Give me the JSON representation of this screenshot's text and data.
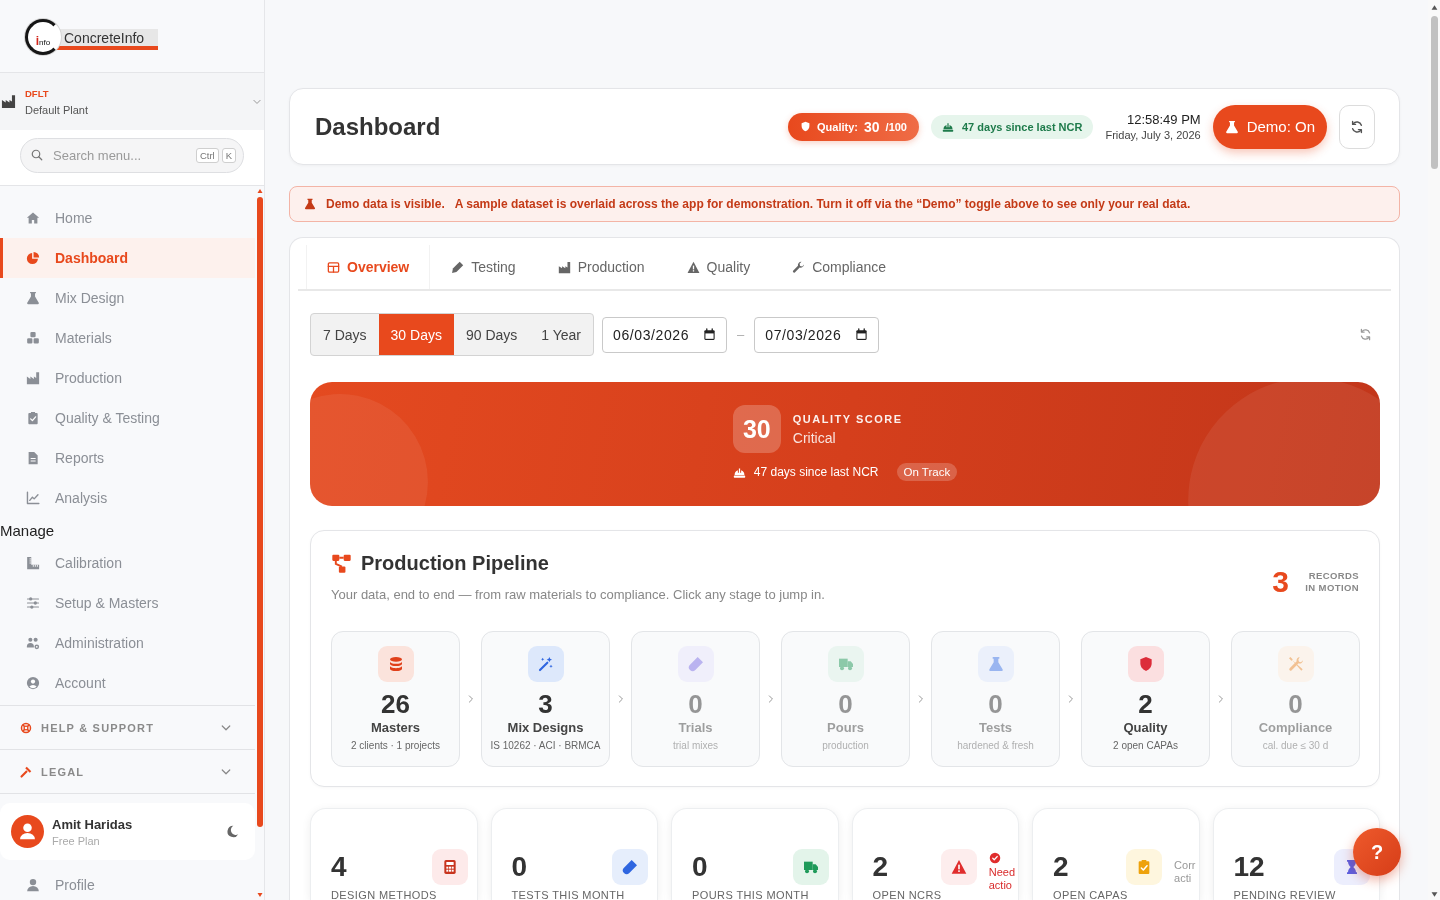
{
  "sidebar": {
    "logo": {
      "mark": "info",
      "text": "ConcreteInfo"
    },
    "plant": {
      "code": "DFLT",
      "name": "Default Plant"
    },
    "search": {
      "placeholder": "Search menu...",
      "shortcut": [
        "Ctrl",
        "K"
      ]
    },
    "nav": [
      {
        "label": "Home",
        "selected": false
      },
      {
        "label": "Dashboard",
        "selected": true
      },
      {
        "label": "Mix Design",
        "selected": false
      },
      {
        "label": "Materials",
        "selected": false
      },
      {
        "label": "Production",
        "selected": false
      },
      {
        "label": "Quality & Testing",
        "selected": false
      },
      {
        "label": "Reports",
        "selected": false
      },
      {
        "label": "Analysis",
        "selected": false
      }
    ],
    "manage_heading": "Manage",
    "manage": [
      {
        "label": "Calibration",
        "selected": false
      },
      {
        "label": "Setup & Masters",
        "selected": false
      },
      {
        "label": "Administration",
        "selected": false
      },
      {
        "label": "Account",
        "selected": false
      }
    ],
    "groups": [
      {
        "label": "HELP & SUPPORT",
        "expanded": false
      },
      {
        "label": "LEGAL",
        "expanded": false
      }
    ],
    "user": {
      "name": "Amit Haridas",
      "plan": "Free Plan"
    },
    "footer_nav": [
      {
        "label": "Profile",
        "selected": false
      }
    ]
  },
  "header": {
    "title": "Dashboard",
    "quality_badge": {
      "label": "Quality:",
      "score": "30",
      "max": "/100"
    },
    "ncr_badge": "47 days since last NCR",
    "time": "12:58:49 PM",
    "date": "Friday, July 3, 2026",
    "demo_button": {
      "label": "Demo: On",
      "on": true
    }
  },
  "demo_banner": {
    "title": "Demo data is visible.",
    "message": "A sample dataset is overlaid across the app for demonstration. Turn it off via the “Demo” toggle above to see only your real data."
  },
  "tabs": [
    {
      "label": "Overview",
      "selected": true
    },
    {
      "label": "Testing",
      "selected": false
    },
    {
      "label": "Production",
      "selected": false
    },
    {
      "label": "Quality",
      "selected": false
    },
    {
      "label": "Compliance",
      "selected": false
    }
  ],
  "range": {
    "presets": [
      {
        "label": "7 Days",
        "selected": false
      },
      {
        "label": "30 Days",
        "selected": true
      },
      {
        "label": "90 Days",
        "selected": false
      },
      {
        "label": "1 Year",
        "selected": false
      }
    ],
    "from": "06/03/2026",
    "separator": "–",
    "to": "07/03/2026"
  },
  "hero": {
    "score": "30",
    "label": "QUALITY SCORE",
    "status": "Critical",
    "ncr": "47 days since last NCR",
    "badge": "On Track"
  },
  "pipeline": {
    "title": "Production Pipeline",
    "subtitle": "Your data, end to end — from raw materials to compliance. Click any stage to jump in.",
    "count": "3",
    "count_label": "RECORDS IN MOTION",
    "stages": [
      {
        "value": "26",
        "label": "Masters",
        "detail": "2 clients · 1 projects",
        "muted": false
      },
      {
        "value": "3",
        "label": "Mix Designs",
        "detail": "IS 10262 · ACI · BRMCA",
        "muted": false
      },
      {
        "value": "0",
        "label": "Trials",
        "detail": "trial mixes",
        "muted": true
      },
      {
        "value": "0",
        "label": "Pours",
        "detail": "production",
        "muted": true
      },
      {
        "value": "0",
        "label": "Tests",
        "detail": "hardened & fresh",
        "muted": true
      },
      {
        "value": "2",
        "label": "Quality",
        "detail": "2 open CAPAs",
        "muted": false
      },
      {
        "value": "0",
        "label": "Compliance",
        "detail": "cal. due ≤ 30 d",
        "muted": true
      }
    ]
  },
  "stats": [
    {
      "value": "4",
      "label": "DESIGN METHODS"
    },
    {
      "value": "0",
      "label": "TESTS THIS MONTH"
    },
    {
      "value": "0",
      "label": "POURS THIS MONTH"
    },
    {
      "value": "2",
      "label": "OPEN NCRS",
      "note": "Need actio",
      "note_alert": true
    },
    {
      "value": "2",
      "label": "OPEN CAPAS",
      "note": "Corr acti",
      "note_alert": false
    },
    {
      "value": "12",
      "label": "PENDING REVIEW"
    }
  ],
  "help_button": "?"
}
